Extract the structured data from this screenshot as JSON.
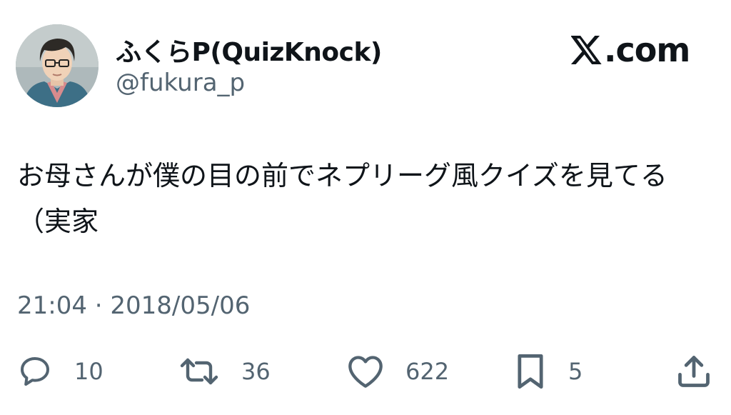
{
  "author": {
    "display_name": "ふくらP(QuizKnock)",
    "handle": "@fukura_p"
  },
  "brand": {
    "site": ".com"
  },
  "tweet": {
    "text": "お母さんが僕の目の前でネプリーグ風クイズを見てる（実家",
    "timestamp": "21:04 · 2018/05/06"
  },
  "actions": {
    "replies": "10",
    "reposts": "36",
    "likes": "622",
    "bookmarks": "5"
  },
  "icons": [
    "reply-icon",
    "repost-icon",
    "like-icon",
    "bookmark-icon",
    "share-icon",
    "x-logo-icon"
  ],
  "colors": {
    "text": "#0f1419",
    "secondary": "#536471",
    "background": "#ffffff"
  }
}
